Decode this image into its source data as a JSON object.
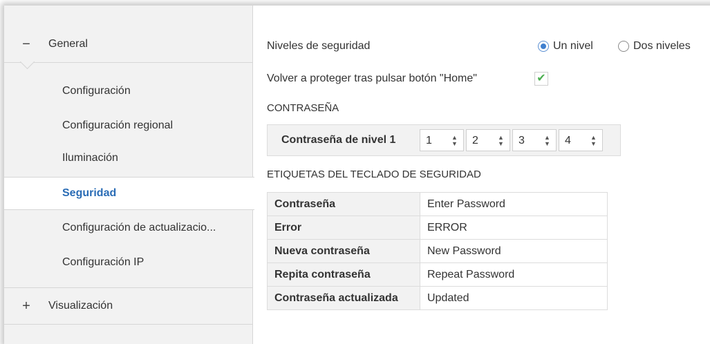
{
  "sidebar": {
    "general": {
      "toggle": "−",
      "label": "General"
    },
    "items": [
      {
        "label": "Configuración"
      },
      {
        "label": "Configuración regional"
      },
      {
        "label": "Iluminación"
      },
      {
        "label": "Seguridad"
      },
      {
        "label": "Configuración de actualizacio..."
      },
      {
        "label": "Configuración IP"
      }
    ],
    "visualizacion": {
      "toggle": "+",
      "label": "Visualización"
    }
  },
  "content": {
    "niveles": {
      "label": "Niveles de seguridad",
      "options": [
        "Un nivel",
        "Dos niveles"
      ],
      "selected": "Un nivel"
    },
    "home": {
      "label": "Volver a proteger tras pulsar botón \"Home\"",
      "checked": true,
      "check_glyph": "✔"
    },
    "contrasena_section": "CONTRASEÑA",
    "password": {
      "label": "Contraseña de nivel 1",
      "digits": [
        "1",
        "2",
        "3",
        "4"
      ]
    },
    "etiquetas_section": "ETIQUETAS DEL TECLADO DE SEGURIDAD",
    "etiquetas": [
      {
        "key": "Contraseña",
        "value": "Enter Password"
      },
      {
        "key": "Error",
        "value": "ERROR"
      },
      {
        "key": "Nueva contraseña",
        "value": "New Password"
      },
      {
        "key": "Repita contraseña",
        "value": "Repeat Password"
      },
      {
        "key": "Contraseña actualizada",
        "value": "Updated"
      }
    ]
  },
  "colors": {
    "accent": "#2a6cb5",
    "check": "#4caf50",
    "radio": "#3f7fcf"
  }
}
